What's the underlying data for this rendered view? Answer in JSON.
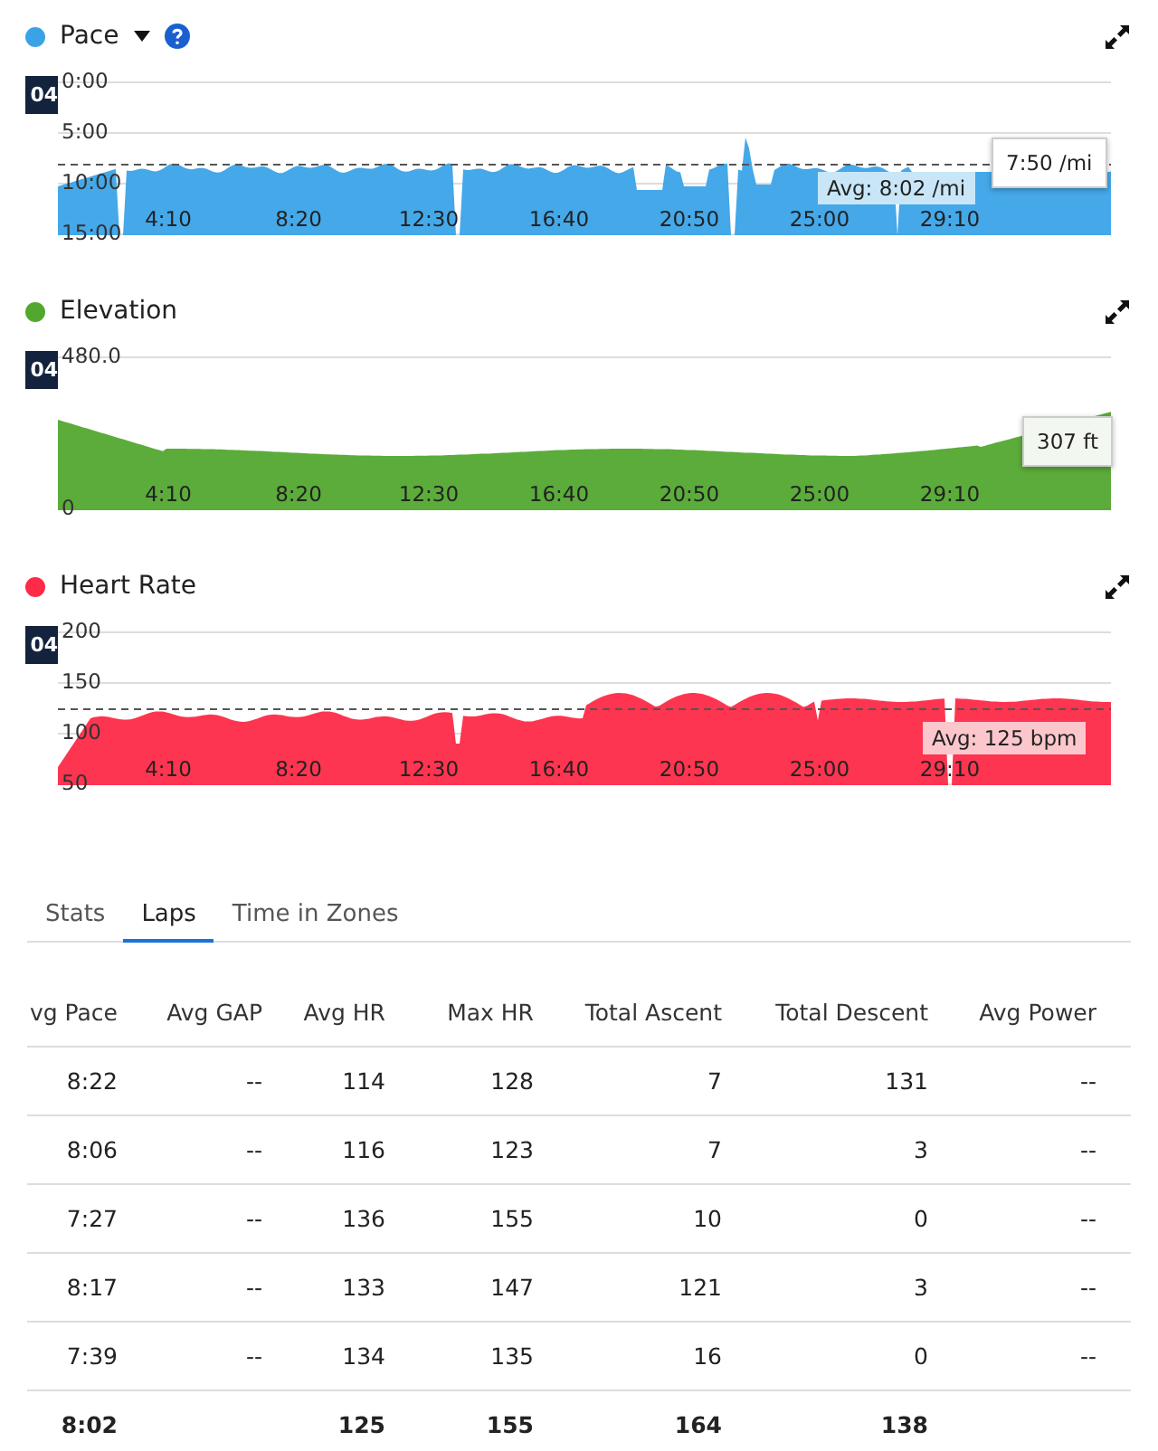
{
  "charts": [
    {
      "kind": "pace",
      "title": "Pace",
      "color": "#3aa3e8",
      "dropdown": true,
      "help": true,
      "cursor_label": "04",
      "yticks": [
        "0:00",
        "5:00",
        "10:00",
        "15:00"
      ],
      "xticks": [
        "4:10",
        "8:20",
        "12:30",
        "16:40",
        "20:50",
        "25:00",
        "29:10"
      ],
      "avg_label": "Avg: 8:02 /mi",
      "tooltip": "7:50 /mi"
    },
    {
      "kind": "elevation",
      "title": "Elevation",
      "color": "#52a82f",
      "dropdown": false,
      "help": false,
      "cursor_label": "04",
      "yticks": [
        "480.0",
        "0"
      ],
      "xticks": [
        "4:10",
        "8:20",
        "12:30",
        "16:40",
        "20:50",
        "25:00",
        "29:10"
      ],
      "tooltip": "307 ft"
    },
    {
      "kind": "heart",
      "title": "Heart Rate",
      "color": "#fe2a47",
      "dropdown": false,
      "help": false,
      "cursor_label": "04",
      "yticks": [
        "200",
        "150",
        "100",
        "50"
      ],
      "xticks": [
        "4:10",
        "8:20",
        "12:30",
        "16:40",
        "20:50",
        "25:00",
        "29:10"
      ],
      "avg_label": "Avg: 125 bpm"
    }
  ],
  "tabs": [
    {
      "label": "Stats",
      "selected": false
    },
    {
      "label": "Laps",
      "selected": true
    },
    {
      "label": "Time in Zones",
      "selected": false
    }
  ],
  "table": {
    "columns": [
      "vg Pace",
      "Avg GAP",
      "Avg HR",
      "Max HR",
      "Total Ascent",
      "Total Descent",
      "Avg Power"
    ],
    "rows": [
      {
        "kind": "lap",
        "cells": [
          "8:22",
          "--",
          "114",
          "128",
          "7",
          "131",
          "--"
        ]
      },
      {
        "kind": "lap",
        "cells": [
          "8:06",
          "--",
          "116",
          "123",
          "7",
          "3",
          "--"
        ]
      },
      {
        "kind": "lap",
        "cells": [
          "7:27",
          "--",
          "136",
          "155",
          "10",
          "0",
          "--"
        ]
      },
      {
        "kind": "lap",
        "cells": [
          "8:17",
          "--",
          "133",
          "147",
          "121",
          "3",
          "--"
        ]
      },
      {
        "kind": "lap",
        "cells": [
          "7:39",
          "--",
          "134",
          "135",
          "16",
          "0",
          "--"
        ]
      },
      {
        "kind": "total",
        "cells": [
          "8:02",
          "",
          "125",
          "155",
          "164",
          "138",
          ""
        ]
      }
    ]
  }
}
